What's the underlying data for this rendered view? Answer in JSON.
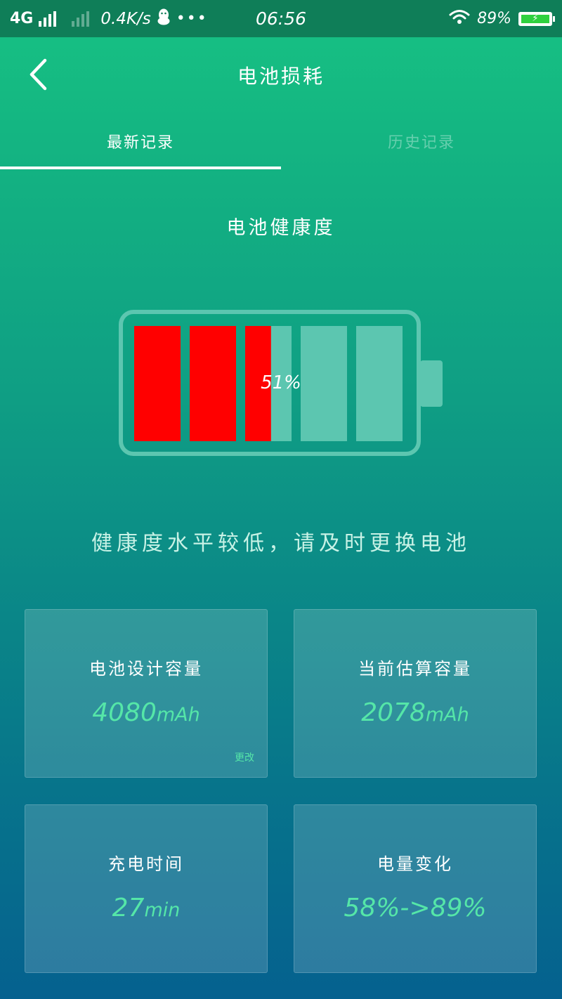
{
  "status_bar": {
    "network_type": "4G",
    "speed": "0.4K/s",
    "more": "•••",
    "time": "06:56",
    "battery_percent": "89%",
    "charging_symbol": "⚡"
  },
  "header": {
    "title": "电池损耗"
  },
  "tabs": [
    {
      "label": "最新记录",
      "active": true
    },
    {
      "label": "历史记录",
      "active": false
    }
  ],
  "battery_health": {
    "title": "电池健康度",
    "percent": 51,
    "percent_label": "51%",
    "fill_color": "#ff0000",
    "empty_color": "#5cc6b0",
    "message": "健康度水平较低，请及时更换电池"
  },
  "cards": [
    {
      "label": "电池设计容量",
      "value": "4080",
      "unit": "mAh",
      "link": "更改"
    },
    {
      "label": "当前估算容量",
      "value": "2078",
      "unit": "mAh"
    },
    {
      "label": "充电时间",
      "value": "27",
      "unit": "min"
    },
    {
      "label": "电量变化",
      "value": "58%->89%",
      "unit": ""
    }
  ],
  "colors": {
    "status_bar_bg": "#0f7e58",
    "accent_value": "#55e6a8"
  }
}
